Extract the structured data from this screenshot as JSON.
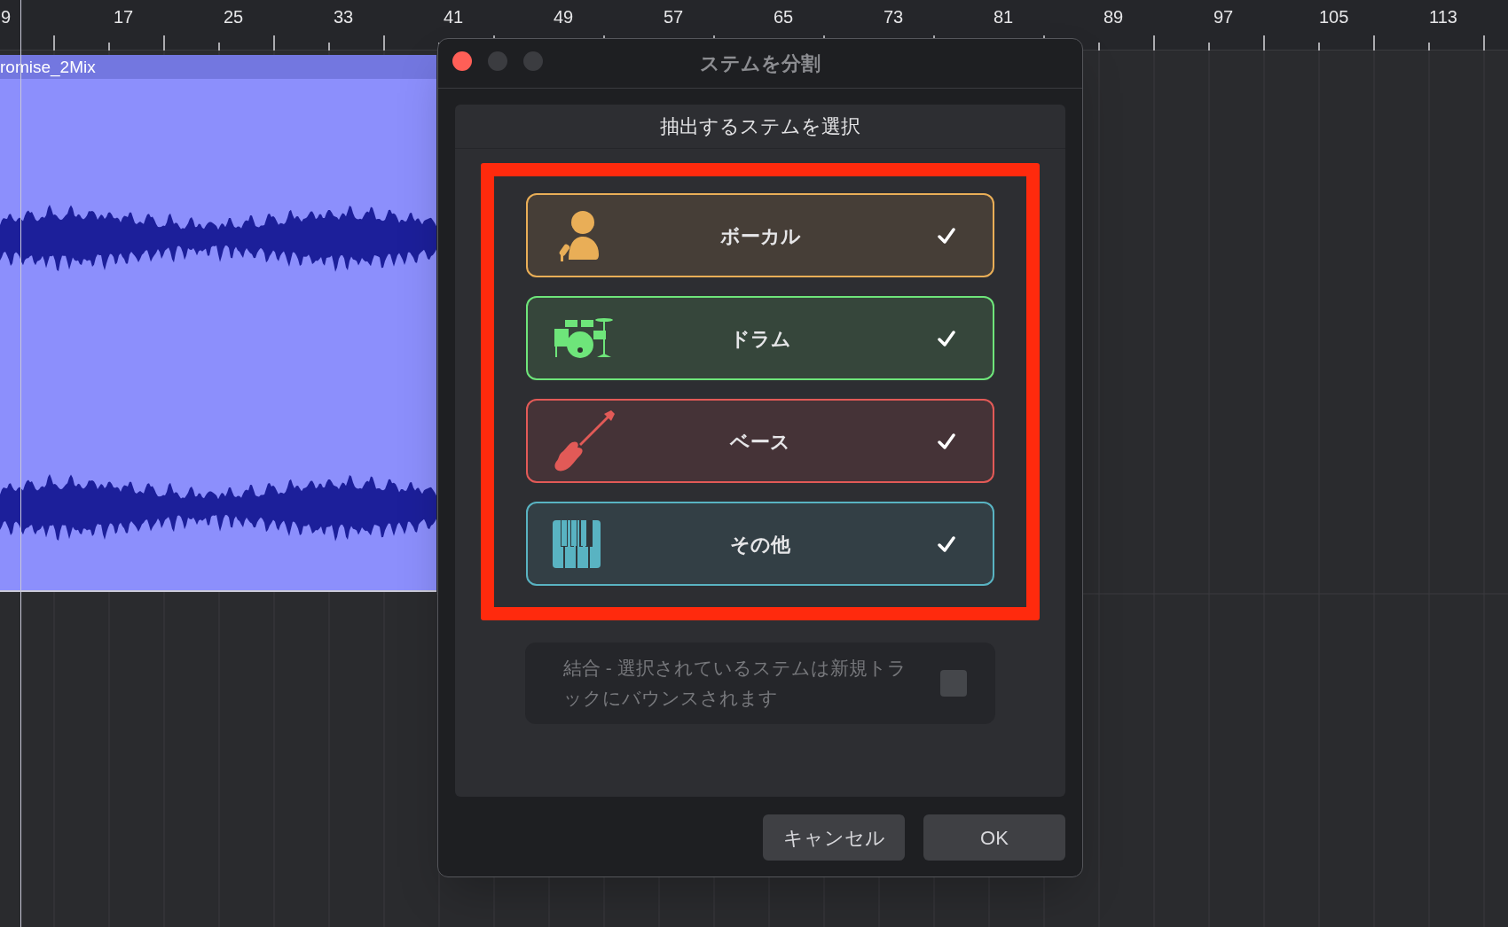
{
  "ruler": {
    "labels": [
      "9",
      "17",
      "25",
      "33",
      "41",
      "49",
      "57",
      "65",
      "73",
      "81",
      "89",
      "97",
      "105",
      "113"
    ]
  },
  "region": {
    "title": "romise_2Mix"
  },
  "dialog": {
    "title": "ステムを分割",
    "header": "抽出するステムを選択",
    "stems": [
      {
        "kind": "vocal",
        "label": "ボーカル",
        "checked": true,
        "color": "#e9ae57"
      },
      {
        "kind": "drums",
        "label": "ドラム",
        "checked": true,
        "color": "#6ee57a"
      },
      {
        "kind": "bass",
        "label": "ベース",
        "checked": true,
        "color": "#e25a57"
      },
      {
        "kind": "other",
        "label": "その他",
        "checked": true,
        "color": "#59b3c2"
      }
    ],
    "combine": {
      "label": "結合 - 選択されているステムは新規トラックにバウンスされます",
      "checked": false,
      "disabled": true
    },
    "buttons": [
      {
        "label": "キャンセル"
      },
      {
        "label": "OK"
      }
    ]
  }
}
